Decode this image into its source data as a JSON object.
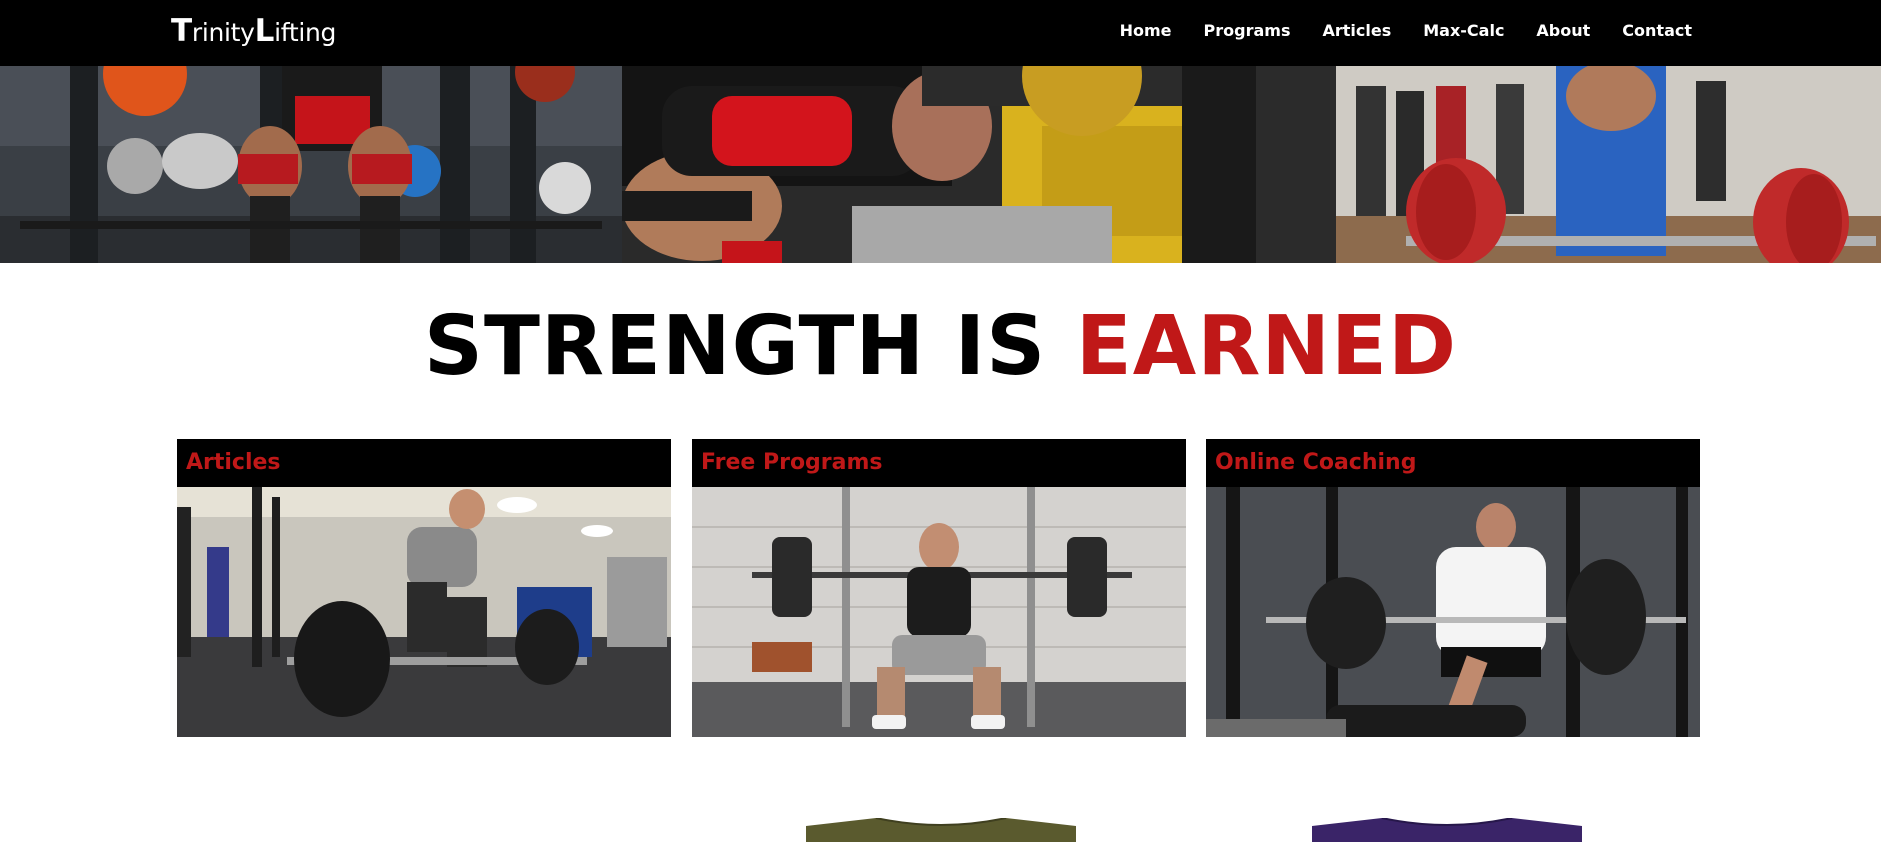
{
  "brand": {
    "initial_1": "T",
    "rest_1": "rinity",
    "initial_2": "L",
    "rest_2": "ifting"
  },
  "nav": {
    "items": [
      {
        "label": "Home"
      },
      {
        "label": "Programs"
      },
      {
        "label": "Articles"
      },
      {
        "label": "Max-Calc"
      },
      {
        "label": "About"
      },
      {
        "label": "Contact"
      }
    ]
  },
  "headline": {
    "part_1": "STRENGTH IS",
    "part_2": "EARNED"
  },
  "cards": [
    {
      "title": "Articles"
    },
    {
      "title": "Free Programs"
    },
    {
      "title": "Online Coaching"
    }
  ],
  "colors": {
    "navbar_bg": "#000000",
    "accent_red": "#c01818",
    "page_bg": "#ffffff",
    "shirt_olive": "#5a5a2e",
    "shirt_purple": "#3a2468"
  },
  "images": {
    "hero": [
      "squat-photo",
      "bench-press-photo",
      "deadlift-competition-photo"
    ],
    "cards": [
      "gym-deadlift-photo",
      "squat-rack-photo",
      "bench-coaching-photo"
    ],
    "merch": [
      "olive-tshirt",
      "purple-tshirt"
    ]
  }
}
